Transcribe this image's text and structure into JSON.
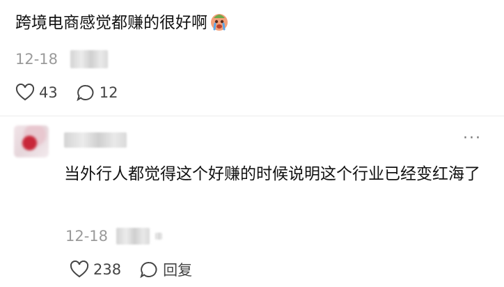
{
  "post": {
    "text": "跨境电商感觉都赚的很好啊",
    "emoji_icon": "crying-face-icon",
    "date": "12-18",
    "likes": "43",
    "comments": "12"
  },
  "comment": {
    "more_label": "···",
    "text": "当外行人都觉得这个好赚的时候说明这个行业已经变红海了",
    "date": "12-18",
    "likes": "238",
    "reply_label": "回复"
  },
  "colors": {
    "text": "#111111",
    "meta": "#9a9a9a",
    "icon": "#444444"
  }
}
